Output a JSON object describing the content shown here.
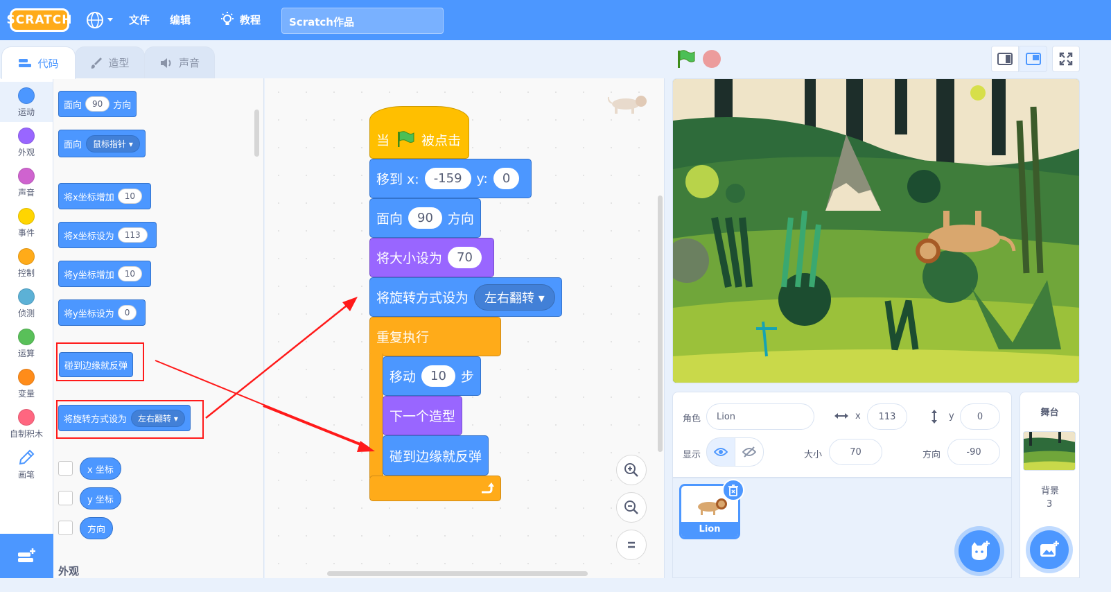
{
  "menubar": {
    "logo": "SCRATCH",
    "file": "文件",
    "edit": "编辑",
    "tutorials": "教程",
    "project_title": "Scratch作品"
  },
  "tabs": [
    {
      "label": "代码",
      "icon": "code-icon"
    },
    {
      "label": "造型",
      "icon": "brush-icon"
    },
    {
      "label": "声音",
      "icon": "speaker-icon"
    }
  ],
  "categories": [
    {
      "label": "运动",
      "color": "#4c97ff"
    },
    {
      "label": "外观",
      "color": "#9966ff"
    },
    {
      "label": "声音",
      "color": "#cf63cf"
    },
    {
      "label": "事件",
      "color": "#ffd500"
    },
    {
      "label": "控制",
      "color": "#ffab19"
    },
    {
      "label": "侦测",
      "color": "#5cb1d6"
    },
    {
      "label": "运算",
      "color": "#59c059"
    },
    {
      "label": "变量",
      "color": "#ff8c1a"
    },
    {
      "label": "自制积木",
      "color": "#ff6680"
    },
    {
      "label": "画笔",
      "color": "#0fbd8c"
    }
  ],
  "palette": {
    "point_direction": {
      "a": "面向",
      "val": "90",
      "b": "方向"
    },
    "point_towards": {
      "a": "面向",
      "drop": "鼠标指针"
    },
    "change_x": {
      "a": "将x坐标增加",
      "val": "10"
    },
    "set_x": {
      "a": "将x坐标设为",
      "val": "113"
    },
    "change_y": {
      "a": "将y坐标增加",
      "val": "10"
    },
    "set_y": {
      "a": "将y坐标设为",
      "val": "0"
    },
    "bounce": "碰到边缘就反弹",
    "rotation_style": {
      "a": "将旋转方式设为",
      "drop": "左右翻转"
    },
    "x_position": "x 坐标",
    "y_position": "y 坐标",
    "direction": "方向",
    "looks_section": "外观"
  },
  "script": {
    "hat": {
      "a": "当",
      "b": "被点击"
    },
    "goto": {
      "a": "移到 x:",
      "x": "-159",
      "b": "y:",
      "y": "0"
    },
    "point": {
      "a": "面向",
      "val": "90",
      "b": "方向"
    },
    "size": {
      "a": "将大小设为",
      "val": "70"
    },
    "rotation": {
      "a": "将旋转方式设为",
      "drop": "左右翻转"
    },
    "forever": "重复执行",
    "move": {
      "a": "移动",
      "val": "10",
      "b": "步"
    },
    "next_costume": "下一个造型",
    "bounce": "碰到边缘就反弹"
  },
  "sprite_info": {
    "sprite_label": "角色",
    "sprite_name": "Lion",
    "x_label": "x",
    "x_value": "113",
    "y_label": "y",
    "y_value": "0",
    "show_label": "显示",
    "size_label": "大小",
    "size_value": "70",
    "direction_label": "方向",
    "direction_value": "-90"
  },
  "sprites": [
    {
      "name": "Lion"
    }
  ],
  "stage_panel": {
    "title": "舞台",
    "backdrops_label": "背景",
    "backdrops_count": "3"
  }
}
